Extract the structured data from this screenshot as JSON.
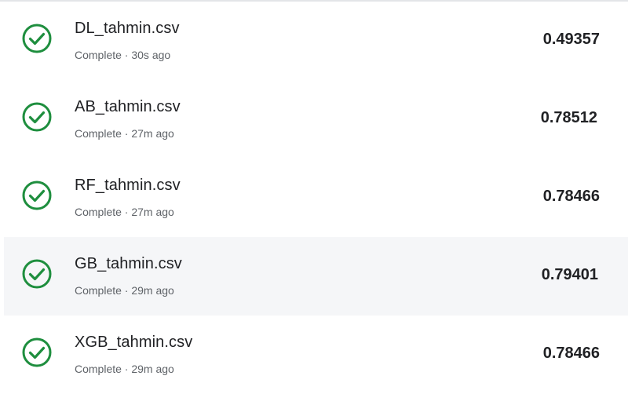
{
  "colors": {
    "check": "#1e8e3e",
    "highlight": "#f5f6f8"
  },
  "submissions": [
    {
      "filename": "DL_tahmin.csv",
      "status": "Complete · 30s ago",
      "score": "0.49357",
      "icon": "check-circle-icon"
    },
    {
      "filename": "AB_tahmin.csv",
      "status": "Complete · 27m ago",
      "score": "0.78512",
      "icon": "check-circle-icon"
    },
    {
      "filename": "RF_tahmin.csv",
      "status": "Complete · 27m ago",
      "score": "0.78466",
      "icon": "check-circle-icon"
    },
    {
      "filename": "GB_tahmin.csv",
      "status": "Complete · 29m ago",
      "score": "0.79401",
      "icon": "check-circle-icon"
    },
    {
      "filename": "XGB_tahmin.csv",
      "status": "Complete · 29m ago",
      "score": "0.78466",
      "icon": "check-circle-icon"
    }
  ]
}
